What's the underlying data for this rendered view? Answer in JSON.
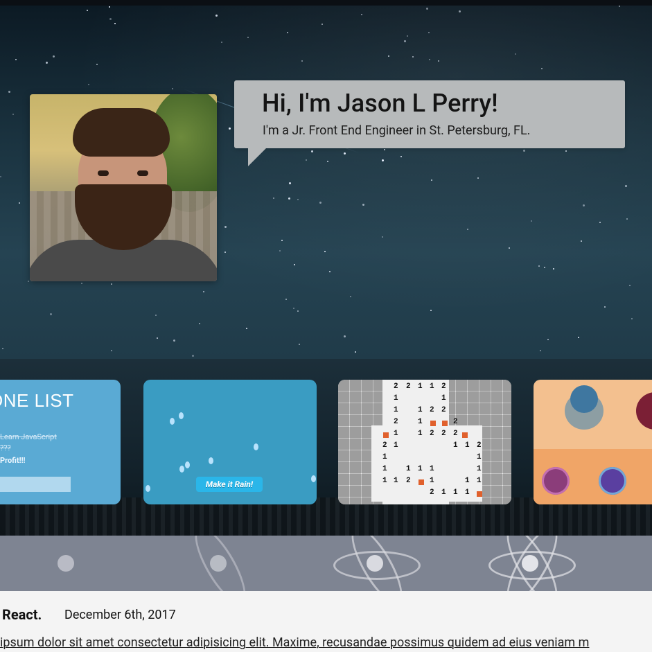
{
  "hero": {
    "headline": "Hi, I'm Jason L Perry!",
    "subheadline": "I'm a Jr. Front End Engineer in St. Petersburg, FL."
  },
  "projects": {
    "cards": [
      {
        "title": "ONE LIST",
        "items": [
          "Learn JavaScript",
          "???",
          "Profit!!!"
        ]
      },
      {
        "button_label": "Make it Rain!"
      },
      {
        "rows": [
          [
            "2",
            "2",
            "1",
            "1",
            "2"
          ],
          [
            "1",
            "",
            "",
            "",
            "1"
          ],
          [
            "1",
            "",
            "1",
            "2",
            "2"
          ],
          [
            "2",
            "",
            "1",
            "⚑",
            "⚑",
            "2"
          ],
          [
            "⚑",
            "1",
            "",
            "1",
            "2",
            "2",
            "2",
            "⚑"
          ],
          [
            "2",
            "1",
            "",
            "",
            "",
            "",
            "1",
            "1",
            "2"
          ],
          [
            "1",
            "",
            "",
            "",
            "",
            "",
            "",
            "",
            "1"
          ],
          [
            "1",
            "",
            "1",
            "1",
            "1",
            "",
            "",
            "",
            "1"
          ],
          [
            "1",
            "1",
            "2",
            "⚑",
            "1",
            "",
            "",
            "1",
            "1"
          ],
          [
            "",
            "",
            "",
            "",
            "2",
            "1",
            "1",
            "1",
            "⚑"
          ]
        ]
      },
      {
        "colors": {
          "bg": "#f3c08f",
          "bottom": "#f0a567",
          "circle1": "#8b3d7a",
          "circle2": "#5a3fa0"
        }
      }
    ]
  },
  "post": {
    "title": "React.",
    "date": "December 6th, 2017",
    "excerpt": "ipsum dolor sit amet consectetur adipisicing elit. Maxime, recusandae possimus quidem ad eius veniam m"
  }
}
